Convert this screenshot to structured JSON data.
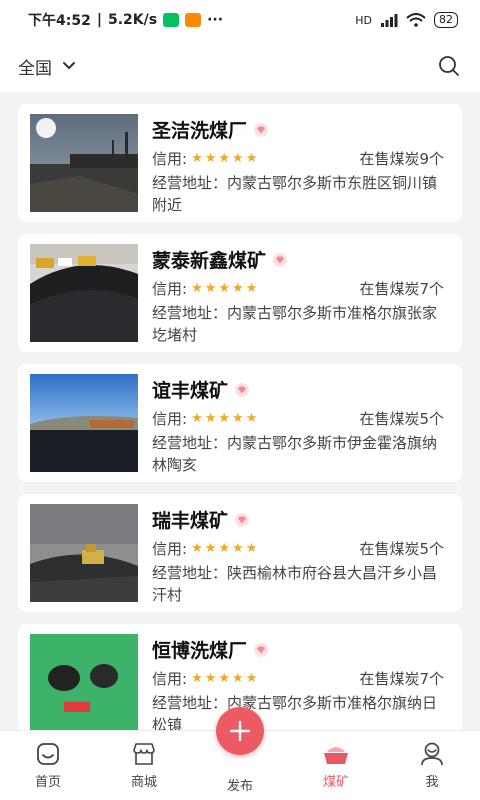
{
  "status_bar": {
    "time": "下午4:52",
    "speed": "5.2K/s",
    "more": "···",
    "network": "HD",
    "battery": "82"
  },
  "top_bar": {
    "region": "全国"
  },
  "labels": {
    "credit": "信用:",
    "address_prefix": "经营地址："
  },
  "mines": [
    {
      "name": "圣洁洗煤厂",
      "stock": "在售煤炭9个",
      "address": "内蒙古鄂尔多斯市东胜区铜川镇附近",
      "rating": 5
    },
    {
      "name": "蒙泰新鑫煤矿",
      "stock": "在售煤炭7个",
      "address": "内蒙古鄂尔多斯市准格尔旗张家圪堵村",
      "rating": 5
    },
    {
      "name": "谊丰煤矿",
      "stock": "在售煤炭5个",
      "address": "内蒙古鄂尔多斯市伊金霍洛旗纳林陶亥",
      "rating": 5
    },
    {
      "name": "瑞丰煤矿",
      "stock": "在售煤炭5个",
      "address": "陕西榆林市府谷县大昌汗乡小昌汗村",
      "rating": 5
    },
    {
      "name": "恒博洗煤厂",
      "stock": "在售煤炭7个",
      "address": "内蒙古鄂尔多斯市准格尔旗纳日松镇",
      "rating": 5
    }
  ],
  "tabs": [
    {
      "label": "首页",
      "icon": "home-icon",
      "active": false
    },
    {
      "label": "商城",
      "icon": "shop-icon",
      "active": false
    },
    {
      "label": "发布",
      "icon": "plus-icon",
      "active": false
    },
    {
      "label": "煤矿",
      "icon": "coal-mine-icon",
      "active": true
    },
    {
      "label": "我",
      "icon": "user-icon",
      "active": false
    }
  ],
  "colors": {
    "accent": "#ec5a64",
    "star": "#f5a623",
    "diamond": "#f08a93"
  }
}
